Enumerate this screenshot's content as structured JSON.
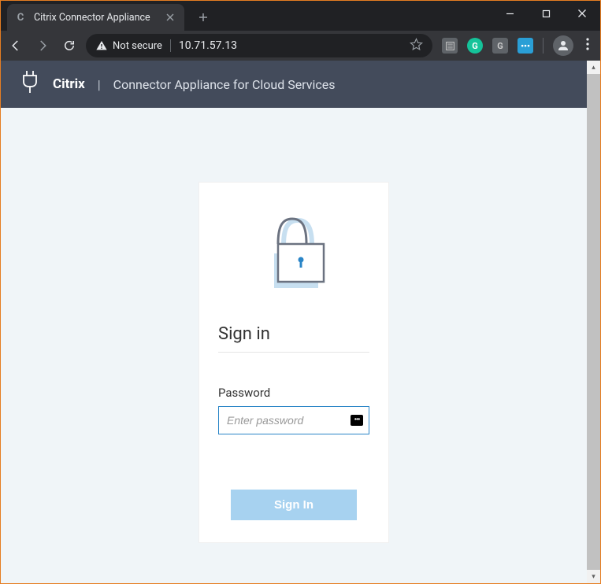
{
  "browser": {
    "tab_title": "Citrix Connector Appliance",
    "security_label": "Not secure",
    "url": "10.71.57.13"
  },
  "header": {
    "brand": "Citrix",
    "separator": "|",
    "subtitle": "Connector Appliance for Cloud Services"
  },
  "login": {
    "title": "Sign in",
    "password_label": "Password",
    "password_placeholder": "Enter password",
    "button_label": "Sign In"
  }
}
